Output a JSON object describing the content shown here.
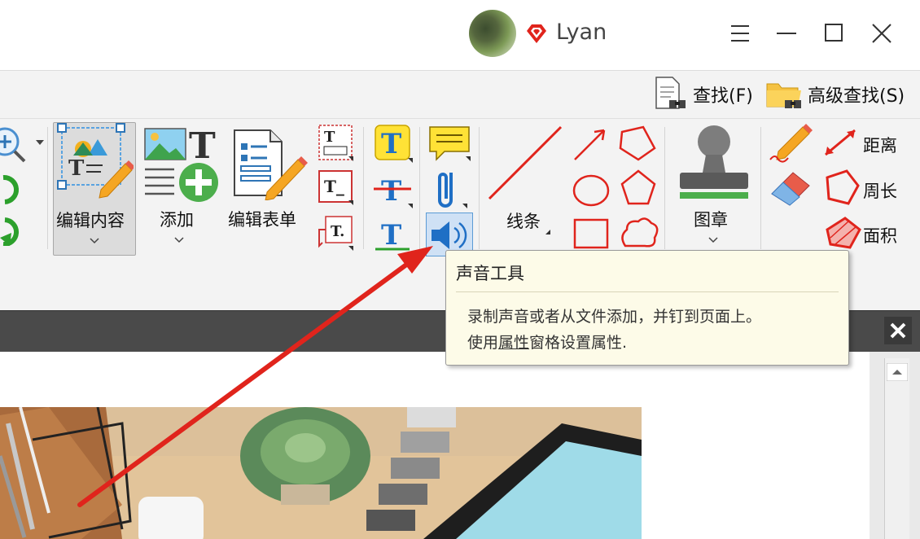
{
  "titlebar": {
    "username": "Lyan"
  },
  "searchbar": {
    "find_label": "查找(F)",
    "advanced_find_label": "高级查找(S)"
  },
  "ribbon": {
    "edit_content_label": "编辑内容",
    "add_label": "添加",
    "edit_form_label": "编辑表单",
    "lines_label": "线条",
    "stamp_label": "图章",
    "distance_label": "距离",
    "perimeter_label": "周长",
    "area_label": "面积"
  },
  "tooltip": {
    "title": "声音工具",
    "line1": "录制声音或者从文件添加，并钉到页面上。",
    "line2_prefix": "使用",
    "line2_link": "属性",
    "line2_suffix": "窗格设置属性."
  },
  "colors": {
    "accent_red": "#e0241c",
    "tooltip_bg": "#fdfbe8",
    "highlight_blue": "#cfe1f5"
  }
}
